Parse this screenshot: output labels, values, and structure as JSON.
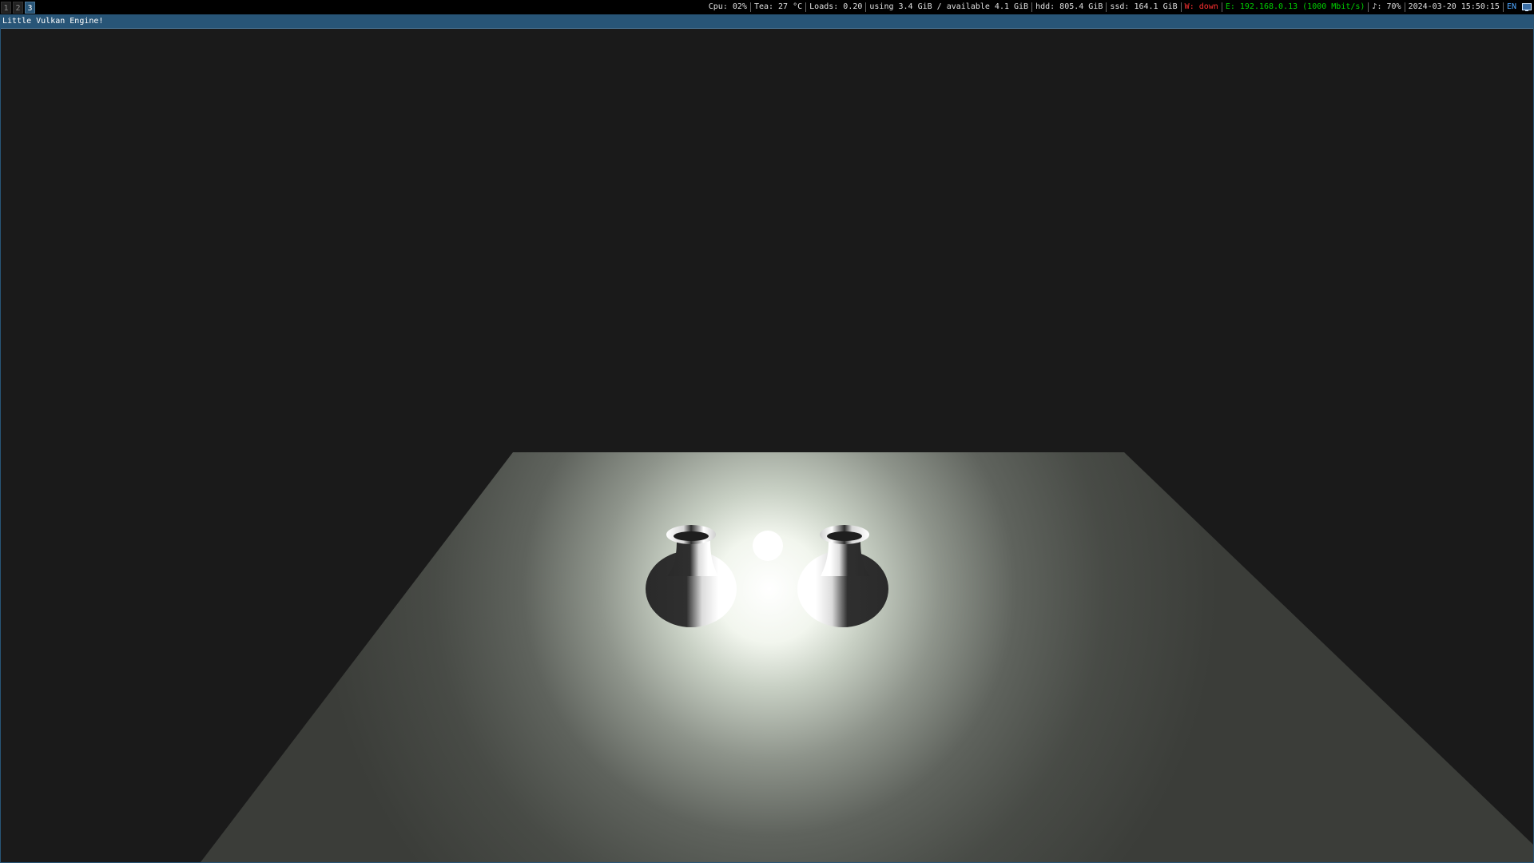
{
  "statusbar": {
    "workspaces": [
      {
        "label": "1",
        "focused": false
      },
      {
        "label": "2",
        "focused": false
      },
      {
        "label": "3",
        "focused": true
      }
    ],
    "items": {
      "cpu": "Cpu: 02%",
      "temp": "Tea: 27 °C",
      "loads": "Loads: 0.20",
      "memory": "using 3.4 GiB / available 4.1 GiB",
      "hdd": "hdd: 805.4 GiB",
      "ssd": "ssd: 164.1 GiB",
      "wifi": "W: down",
      "ethernet": "E: 192.168.0.13 (1000 Mbit/s)",
      "volume": "♪: 70%",
      "datetime": "2024-03-20 15:50:15",
      "keyboard_layout": "EN"
    },
    "colors": {
      "wifi_down": "#ff3030",
      "ethernet_up": "#00d000",
      "layout": "#4ea6ff",
      "focused_workspace": "#285577"
    },
    "tray_icon": "display-icon"
  },
  "window": {
    "title": "Little Vulkan Engine!",
    "border_color": "#285577"
  },
  "scene": {
    "objects": [
      "floor-plane",
      "vase-left",
      "light-sphere",
      "vase-right"
    ],
    "background_color": "#1a1a1a",
    "floor_color": "#3b3d39",
    "light_color": "#ffffff"
  }
}
